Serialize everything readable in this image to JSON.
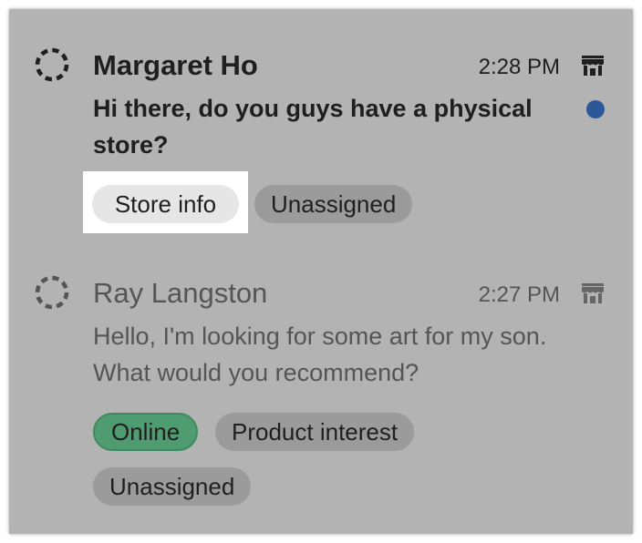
{
  "conversations": [
    {
      "name": "Margaret Ho",
      "time": "2:28 PM",
      "message": "Hi there, do you guys have a physical store?",
      "unread": true,
      "tags": [
        "Store info",
        "Unassigned"
      ]
    },
    {
      "name": "Ray Langston",
      "time": "2:27 PM",
      "message": "Hello, I'm looking for some art for my son. What would you recommend?",
      "unread": false,
      "tags": [
        "Online",
        "Product interest",
        "Unassigned"
      ]
    }
  ],
  "icons": {
    "avatar": "loading-spinner-icon",
    "channel": "store-icon",
    "unread": "unread-dot"
  },
  "colors": {
    "unread_dot": "#2c5798",
    "online_tag": "#4e9c6f",
    "tag_default": "#9b9b9b",
    "tag_highlighted": "#e6e6e6",
    "background": "#b3b3b3"
  }
}
